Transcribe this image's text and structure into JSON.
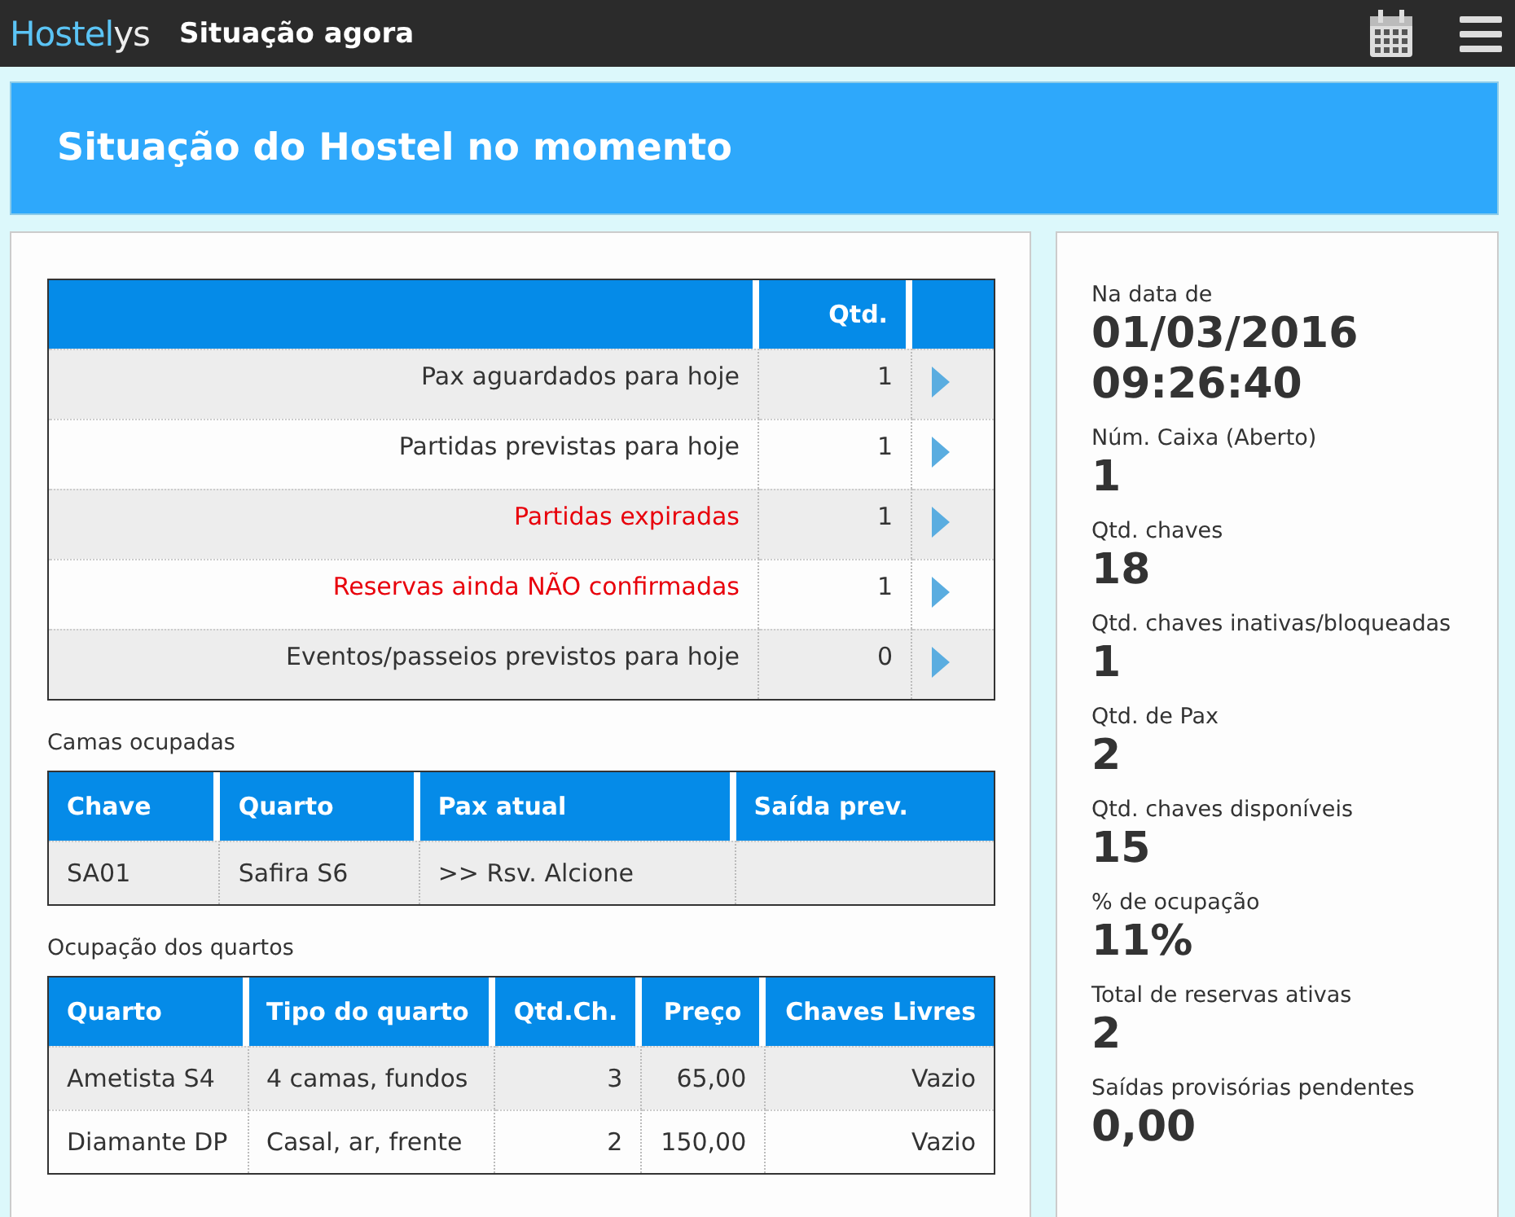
{
  "topbar": {
    "brand_part_1": "Hostel",
    "brand_part_2": "ys",
    "title": "Situação agora"
  },
  "banner": {
    "title": "Situação do Hostel no momento"
  },
  "summary": {
    "columns": [
      "Qtd."
    ],
    "rows": [
      {
        "label": "Pax aguardados para hoje",
        "qty": "1",
        "alert": false
      },
      {
        "label": "Partidas previstas para hoje",
        "qty": "1",
        "alert": false
      },
      {
        "label": "Partidas expiradas",
        "qty": "1",
        "alert": true
      },
      {
        "label": "Reservas ainda NÃO confirmadas",
        "qty": "1",
        "alert": true
      },
      {
        "label": "Eventos/passeios previstos para hoje",
        "qty": "0",
        "alert": false
      }
    ]
  },
  "beds": {
    "title": "Camas ocupadas",
    "columns": [
      "Chave",
      "Quarto",
      "Pax atual",
      "Saída prev."
    ],
    "rows": [
      [
        "SA01",
        "Safira S6",
        ">> Rsv. Alcione",
        ""
      ]
    ]
  },
  "rooms": {
    "title": "Ocupação dos quartos",
    "columns": [
      "Quarto",
      "Tipo do quarto",
      "Qtd.Ch.",
      "Preço",
      "Chaves Livres"
    ],
    "rows": [
      [
        "Ametista S4",
        "4 camas, fundos",
        "3",
        "65,00",
        "Vazio"
      ],
      [
        "Diamante DP",
        "Casal, ar, frente",
        "2",
        "150,00",
        "Vazio"
      ]
    ]
  },
  "stats": [
    {
      "label": "Na data de",
      "value": "01/03/2016 09:26:40"
    },
    {
      "label": "Núm. Caixa (Aberto)",
      "value": "1"
    },
    {
      "label": "Qtd. chaves",
      "value": "18"
    },
    {
      "label": "Qtd. chaves inativas/bloqueadas",
      "value": "1"
    },
    {
      "label": "Qtd. de Pax",
      "value": "2"
    },
    {
      "label": "Qtd. chaves disponíveis",
      "value": "15"
    },
    {
      "label": "% de ocupação",
      "value": "11%"
    },
    {
      "label": "Total de reservas ativas",
      "value": "2"
    },
    {
      "label": "Saídas provisórias pendentes",
      "value": "0,00"
    }
  ]
}
